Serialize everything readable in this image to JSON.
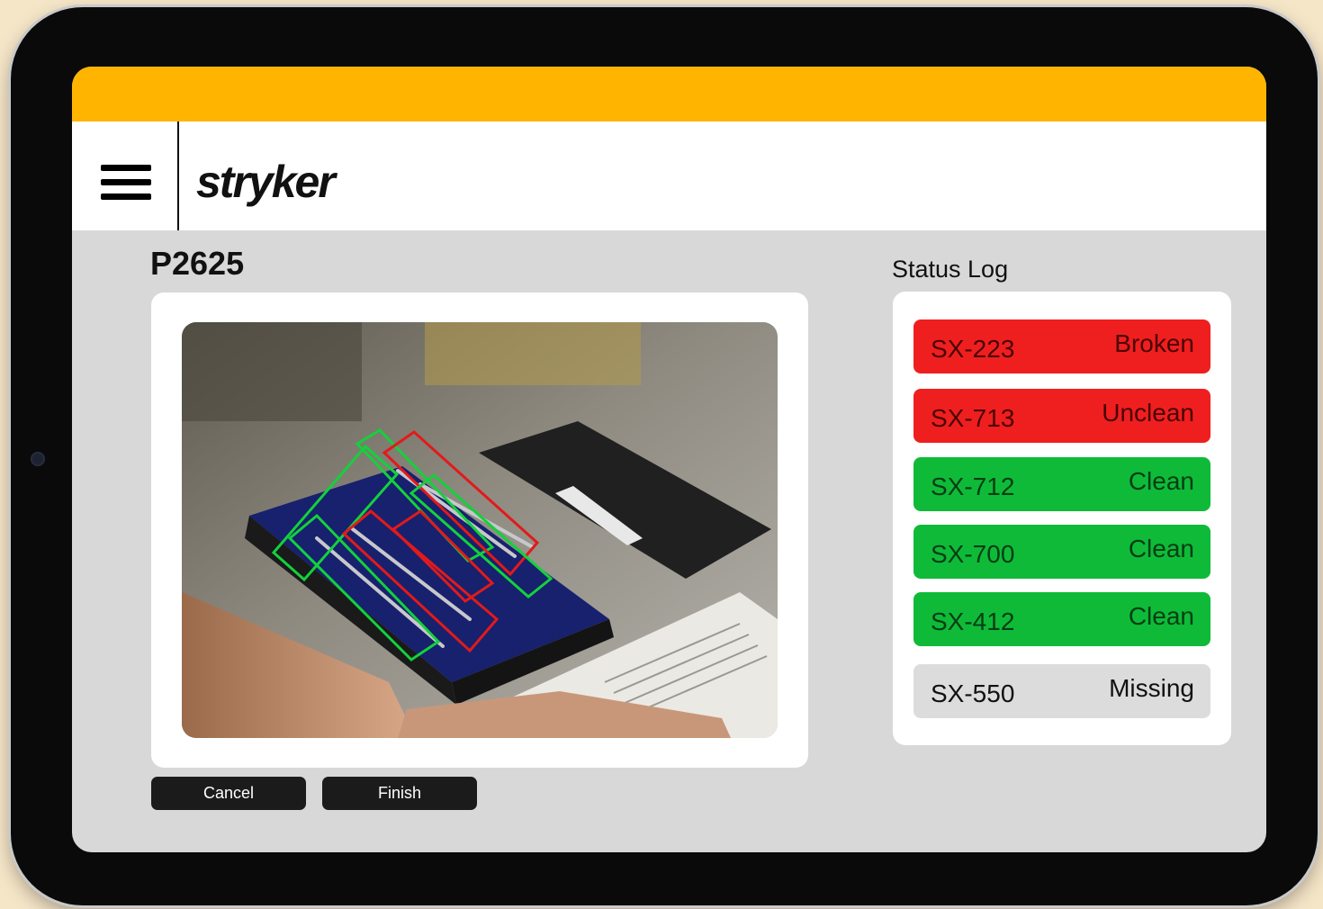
{
  "brand": {
    "logo_text": "stryker",
    "accent_color": "#FFB500"
  },
  "header": {
    "menu_icon": "hamburger-menu-icon"
  },
  "main": {
    "title": "P2625",
    "image_description_icon": "instrument-tray-photo"
  },
  "buttons": {
    "cancel_label": "Cancel",
    "finish_label": "Finish"
  },
  "status_log": {
    "title": "Status Log",
    "items": [
      {
        "id": "SX-223",
        "status": "Broken",
        "color": "#ef1f1f"
      },
      {
        "id": "SX-713",
        "status": "Unclean",
        "color": "#ef1f1f"
      },
      {
        "id": "SX-712",
        "status": "Clean",
        "color": "#0fba38"
      },
      {
        "id": "SX-700",
        "status": "Clean",
        "color": "#0fba38"
      },
      {
        "id": "SX-412",
        "status": "Clean",
        "color": "#0fba38"
      },
      {
        "id": "SX-550",
        "status": "Missing",
        "color": "#dcdcdc"
      }
    ]
  }
}
